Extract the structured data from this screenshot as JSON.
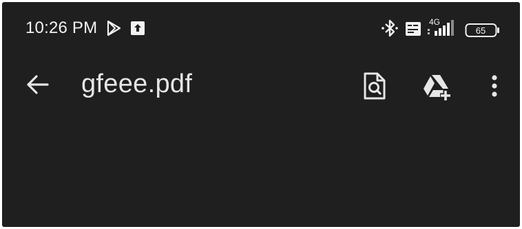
{
  "status_bar": {
    "time": "10:26 PM",
    "notification_icons": [
      "play-store-icon",
      "upload-icon"
    ],
    "system_icons": [
      "bluetooth-icon",
      "volte-icon",
      "signal-icon",
      "battery-icon"
    ],
    "network": "4G",
    "battery_level": "65"
  },
  "app_bar": {
    "title": "gfeee.pdf",
    "actions": [
      "search-document",
      "add-to-drive",
      "more-options"
    ]
  },
  "colors": {
    "background": "#1f1f1f",
    "text": "#e6e6e6"
  }
}
